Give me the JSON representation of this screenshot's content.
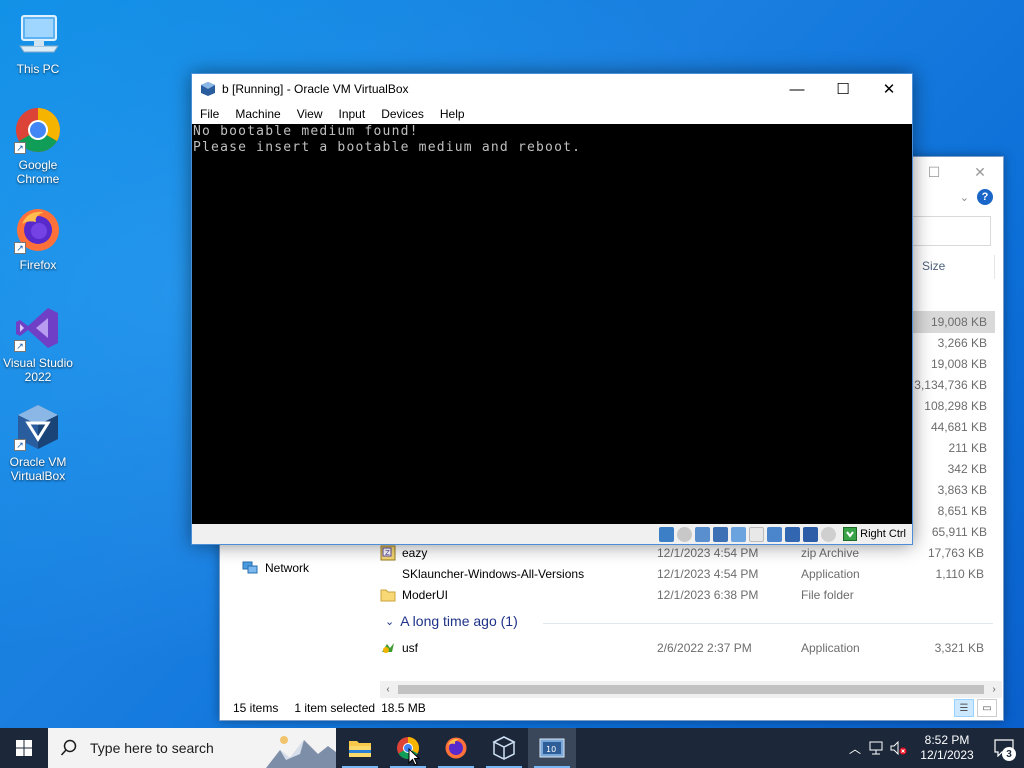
{
  "desktop": {
    "icons": [
      {
        "label": "This PC",
        "icon": "this-pc-icon"
      },
      {
        "label": "Google Chrome",
        "icon": "chrome-icon"
      },
      {
        "label": "Firefox",
        "icon": "firefox-icon"
      },
      {
        "label": "Visual Studio 2022",
        "icon": "visual-studio-icon"
      },
      {
        "label": "Oracle VM VirtualBox",
        "icon": "virtualbox-icon"
      }
    ]
  },
  "vbox": {
    "title": "b [Running] - Oracle VM VirtualBox",
    "menu": [
      "File",
      "Machine",
      "View",
      "Input",
      "Devices",
      "Help"
    ],
    "screen_lines": [
      "No bootable medium found!",
      "Please insert a bootable medium and reboot."
    ],
    "host_key": "Right Ctrl",
    "window_controls": [
      "minimize",
      "maximize",
      "close"
    ]
  },
  "explorer": {
    "column_size": "Size",
    "sizes_visible": [
      "19,008 KB",
      "3,266 KB",
      "19,008 KB",
      "3,134,736 KB",
      "108,298 KB",
      "44,681 KB",
      "211 KB",
      "342 KB",
      "3,863 KB",
      "8,651 KB",
      "65,911 KB"
    ],
    "nav_network": "Network",
    "rows": [
      {
        "name": "eazy",
        "date": "12/1/2023 4:54 PM",
        "type": "zip Archive",
        "size": "17,763 KB",
        "icon": "zip-icon"
      },
      {
        "name": "SKlauncher-Windows-All-Versions",
        "date": "12/1/2023 4:54 PM",
        "type": "Application",
        "size": "1,110 KB",
        "icon": "app-icon"
      },
      {
        "name": "ModerUI",
        "date": "12/1/2023 6:38 PM",
        "type": "File folder",
        "size": "",
        "icon": "folder-icon"
      }
    ],
    "group_label": "A long time ago (1)",
    "old_rows": [
      {
        "name": "usf",
        "date": "2/6/2022 2:37 PM",
        "type": "Application",
        "size": "3,321 KB",
        "icon": "exe-icon"
      }
    ],
    "status": {
      "items": "15 items",
      "selected": "1 item selected",
      "size": "18.5 MB"
    },
    "help": "?"
  },
  "taskbar": {
    "search_placeholder": "Type here to search",
    "apps": [
      "file-explorer-icon",
      "chrome-icon",
      "firefox-icon",
      "virtualbox-icon",
      "virtualbox-vm-icon"
    ],
    "time": "8:52 PM",
    "date": "12/1/2023",
    "notification_count": "3"
  },
  "colors": {
    "desktop_blue": "#0f8fe6",
    "taskbar": "#1c2839",
    "accent": "#1a66c8"
  }
}
